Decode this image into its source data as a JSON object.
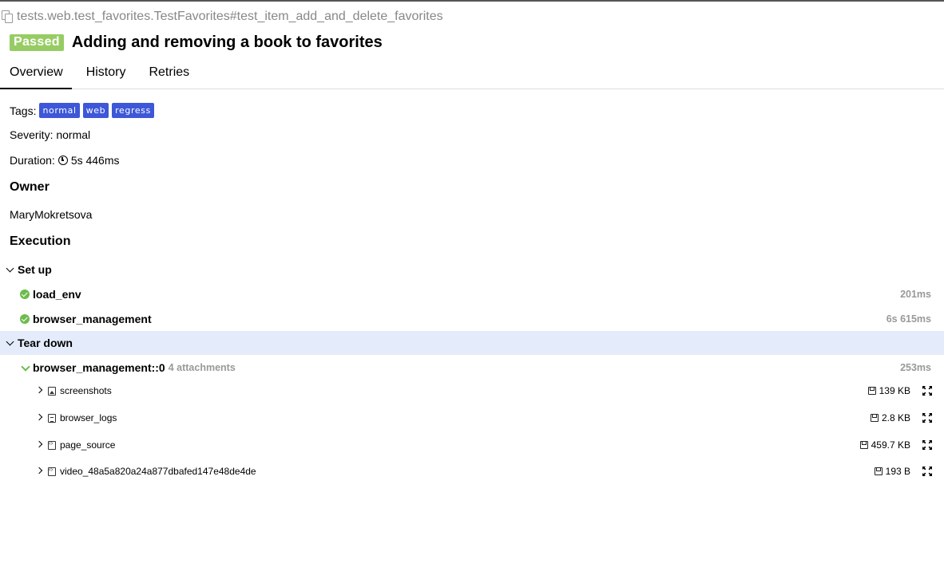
{
  "test_path": "tests.web.test_favorites.TestFavorites#test_item_add_and_delete_favorites",
  "status": "Passed",
  "title": "Adding and removing a book to favorites",
  "tabs": [
    {
      "label": "Overview",
      "active": true
    },
    {
      "label": "History",
      "active": false
    },
    {
      "label": "Retries",
      "active": false
    }
  ],
  "tags": {
    "label": "Tags:",
    "items": [
      "normal",
      "web",
      "regress"
    ]
  },
  "severity": "Severity: normal",
  "duration": {
    "label": "Duration:",
    "value": "5s 446ms"
  },
  "owner": {
    "heading": "Owner",
    "value": "MaryMokretsova"
  },
  "execution": {
    "heading": "Execution",
    "setup": {
      "label": "Set up",
      "steps": [
        {
          "name": "load_env",
          "duration": "201ms"
        },
        {
          "name": "browser_management",
          "duration": "6s 615ms"
        }
      ]
    },
    "teardown": {
      "label": "Tear down",
      "step": {
        "name": "browser_management::0",
        "attachments": "4 attachments",
        "duration": "253ms"
      },
      "attachments": [
        {
          "name": "screenshots",
          "size": "139 KB",
          "icon": "image-file-icon"
        },
        {
          "name": "browser_logs",
          "size": "2.8 KB",
          "icon": "text-file-icon"
        },
        {
          "name": "page_source",
          "size": "459.7 KB",
          "icon": "code-file-icon"
        },
        {
          "name": "video_48a5a820a24a877dbafed147e48de4de",
          "size": "193 B",
          "icon": "code-file-icon"
        }
      ]
    }
  },
  "colors": {
    "passed": "#97cc64",
    "tag": "#3d57d8",
    "ok": "#6cbc4b",
    "highlight": "#e4ebfa"
  }
}
